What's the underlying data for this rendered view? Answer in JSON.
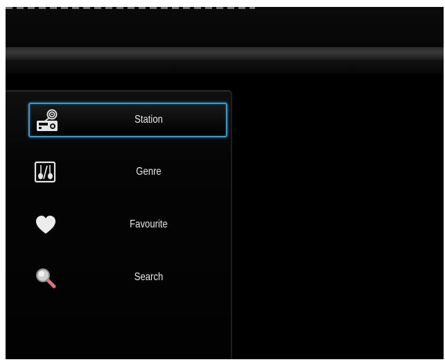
{
  "menu": {
    "items": [
      {
        "label": "Station",
        "icon": "radio-station-icon",
        "selected": true
      },
      {
        "label": "Genre",
        "icon": "guitar-genre-icon",
        "selected": false
      },
      {
        "label": "Favourite",
        "icon": "heart-icon",
        "selected": false
      },
      {
        "label": "Search",
        "icon": "magnifier-icon",
        "selected": false
      }
    ]
  },
  "colors": {
    "background": "#000000",
    "selection_border": "#2f9fd6",
    "text": "#e8e8e8"
  }
}
